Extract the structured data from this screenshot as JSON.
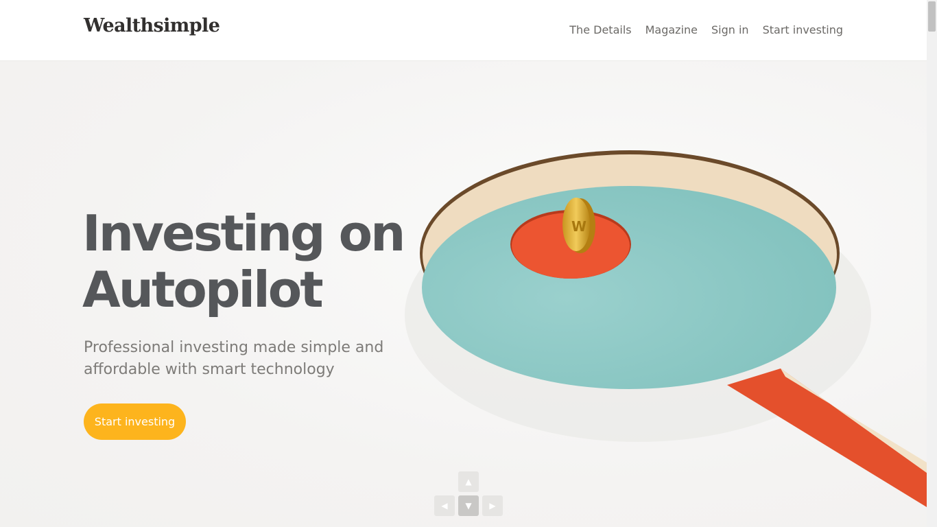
{
  "header": {
    "logo": "Wealthsimple",
    "nav": [
      "The Details",
      "Magazine",
      "Sign in",
      "Start investing"
    ]
  },
  "hero": {
    "title_line1": "Investing on",
    "title_line2": "Autopilot",
    "subtitle": "Professional investing made simple and affordable with smart technology",
    "cta": "Start investing"
  },
  "controls": {
    "up": "▲",
    "left": "◀",
    "down": "▼",
    "right": "▶"
  },
  "colors": {
    "accent": "#fdb41d",
    "teal": "#8ecac7",
    "orange": "#e9512e",
    "coin": "#e2b33a"
  }
}
